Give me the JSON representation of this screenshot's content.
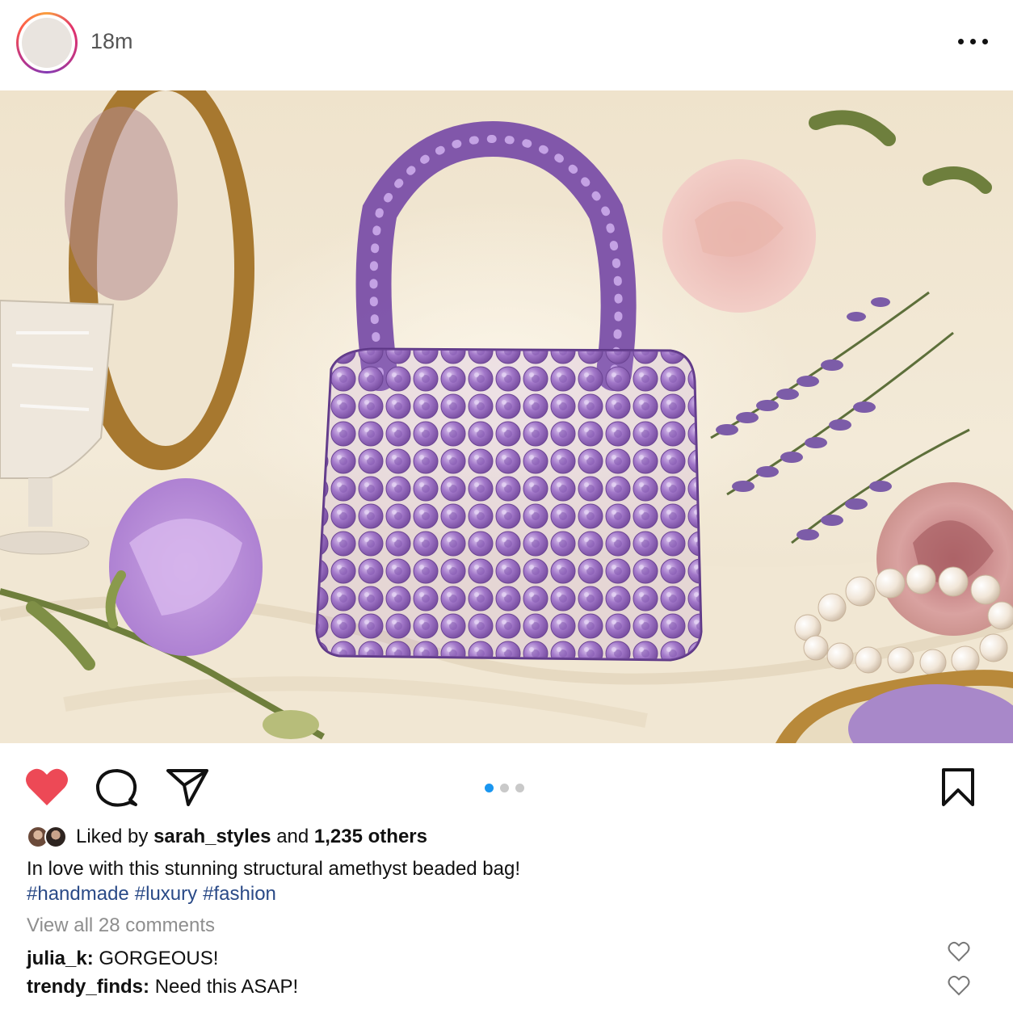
{
  "post": {
    "timestamp": "18m",
    "more_icon": "more-horizontal-icon",
    "image_alt": "Purple beaded handbag with roses, lavender and pearls",
    "carousel": {
      "count": 3,
      "active_index": 0
    }
  },
  "actions": {
    "like_icon": "heart-filled-icon",
    "comment_icon": "comment-icon",
    "share_icon": "send-icon",
    "save_icon": "bookmark-icon",
    "like_color": "#ed4956"
  },
  "likes": {
    "prefix": "Liked by",
    "user": "sarah_styles",
    "middle": "and",
    "others": "1,235 others"
  },
  "caption": {
    "text": "In love with this stunning structural amethyst beaded bag!",
    "hashtags": [
      "#handmade",
      "#luxury",
      "#fashion"
    ]
  },
  "comments": {
    "view_all": "View all 28 comments",
    "items": [
      {
        "user": "julia_k:",
        "text": "GORGEOUS!"
      },
      {
        "user": "trendy_finds:",
        "text": "Need this ASAP!"
      }
    ]
  },
  "colors": {
    "accent_blue": "#1a96f0",
    "hashtag": "#2a4a87",
    "bag_purple": "#8a5fb4"
  }
}
